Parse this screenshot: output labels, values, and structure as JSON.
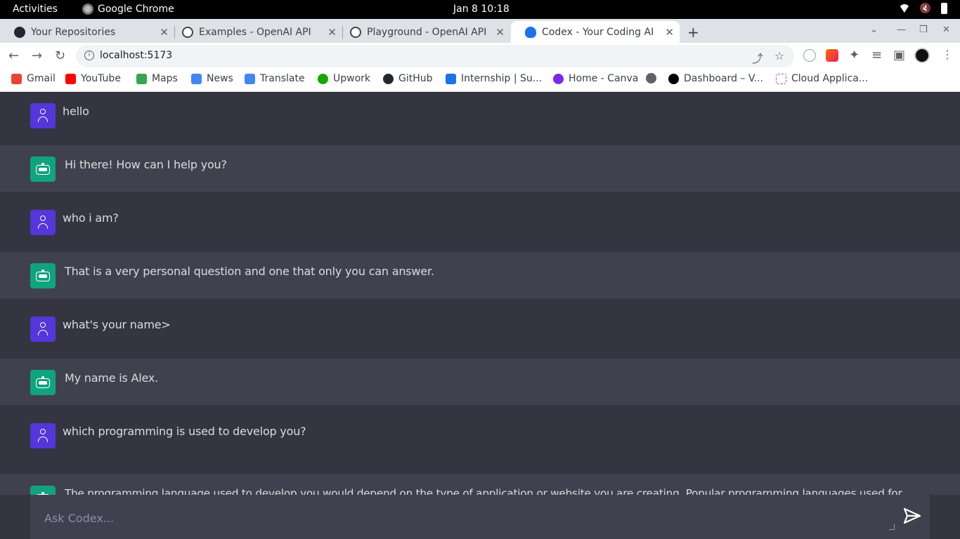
{
  "system_bar": {
    "activities": "Activities",
    "app_name": "Google Chrome",
    "clock": "Jan 8  10:18"
  },
  "tabs": [
    {
      "title": "Your Repositories",
      "icon": "github-icon",
      "active": false
    },
    {
      "title": "Examples - OpenAI API",
      "icon": "openai-icon",
      "active": false
    },
    {
      "title": "Playground - OpenAI API",
      "icon": "openai-icon",
      "active": false
    },
    {
      "title": "Codex - Your Coding AI",
      "icon": "codex-icon",
      "active": true
    }
  ],
  "address_bar": {
    "url": "localhost:5173"
  },
  "bookmarks": [
    {
      "label": "Gmail",
      "color": "#ea4335"
    },
    {
      "label": "YouTube",
      "color": "#ff0000"
    },
    {
      "label": "Maps",
      "color": "#34a853"
    },
    {
      "label": "News",
      "color": "#4285f4"
    },
    {
      "label": "Translate",
      "color": "#4285f4"
    },
    {
      "label": "Upwork",
      "color": "#14a800"
    },
    {
      "label": "GitHub",
      "color": "#24292f"
    },
    {
      "label": "Internship | Su...",
      "color": "#1a73e8"
    },
    {
      "label": "Home - Canva",
      "color": "#7d2ae8"
    },
    {
      "label": "",
      "color": "#5f6368"
    },
    {
      "label": "Dashboard – V...",
      "color": "#000000"
    },
    {
      "label": "Cloud Applica...",
      "color": "#a142f4"
    }
  ],
  "messages": [
    {
      "role": "user",
      "text": "hello"
    },
    {
      "role": "ai",
      "text": "Hi there! How can I help you?"
    },
    {
      "role": "user",
      "text": "who i am?"
    },
    {
      "role": "ai",
      "text": "That is a very personal question and one that only you can answer."
    },
    {
      "role": "user",
      "text": "what's your name>"
    },
    {
      "role": "ai",
      "text": "My name is Alex."
    },
    {
      "role": "user",
      "text": "which programming is used to develop you?"
    },
    {
      "role": "ai",
      "text": "The programming language used to develop you would depend on the type of application or website you are creating. Popular programming languages used for"
    }
  ],
  "composer": {
    "placeholder": "Ask Codex..."
  },
  "colors": {
    "background": "#343541",
    "ai_row": "#40414f",
    "user_avatar": "#5436da",
    "bot_avatar": "#10a37f"
  }
}
